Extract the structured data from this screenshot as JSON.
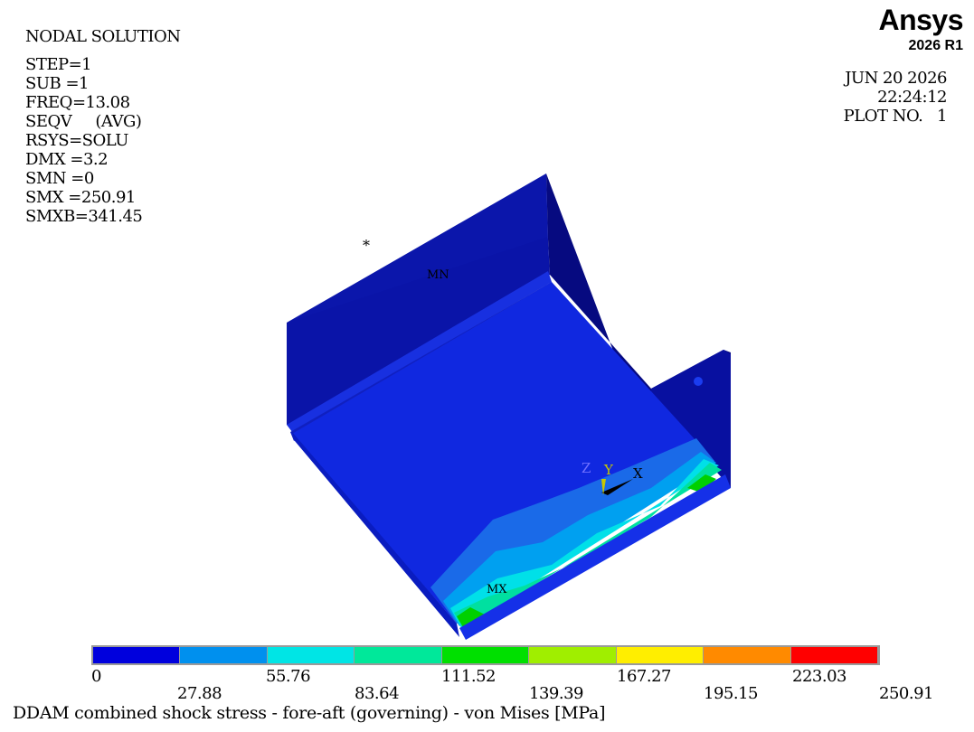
{
  "header": {
    "lines": [
      "NODAL SOLUTION",
      "STEP=1",
      "SUB =1",
      "FREQ=13.08",
      "SEQV     (AVG)",
      "RSYS=SOLU",
      "DMX =3.2",
      "SMN =0",
      "SMX =250.91",
      "SMXB=341.45"
    ]
  },
  "brand": {
    "name": "Ansys",
    "version": "2026 R1"
  },
  "plot_info": {
    "date": "JUN 20 2026",
    "time": "22:24:12",
    "plot_no": "PLOT NO.   1"
  },
  "markers": {
    "min": "MN",
    "max": "MX",
    "star": "*"
  },
  "triad": {
    "z": "Z",
    "y": "Y",
    "x": "X"
  },
  "legend": {
    "colors": [
      "#0000dd",
      "#0090ee",
      "#00e5e5",
      "#00e89a",
      "#00e000",
      "#a0ee00",
      "#ffee00",
      "#ff8a00",
      "#ff0000"
    ],
    "upper_ticks": [
      "0",
      "55.76",
      "111.52",
      "167.27",
      "223.03"
    ],
    "lower_ticks": [
      "27.88",
      "83.64",
      "139.39",
      "195.15",
      "250.91"
    ]
  },
  "caption": "DDAM combined shock stress - fore-aft (governing) - von Mises [MPa]"
}
